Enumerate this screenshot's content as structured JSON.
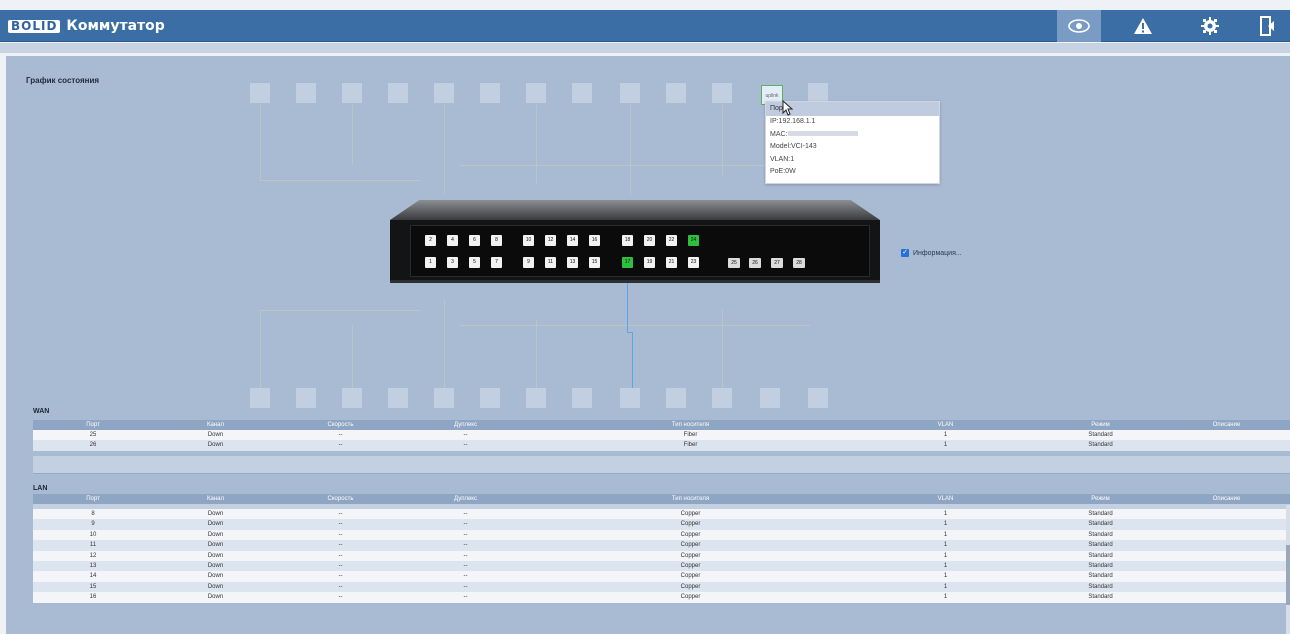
{
  "app": {
    "brand": "BOLID",
    "title": "Коммутатор"
  },
  "topbar": {
    "icons": [
      {
        "name": "eye-icon",
        "active": true
      },
      {
        "name": "alert-icon",
        "active": false
      },
      {
        "name": "gear-icon",
        "active": false
      },
      {
        "name": "logout-icon",
        "active": false
      }
    ]
  },
  "status_graph": {
    "title": "График состояния",
    "info_checkbox_label": "Информация..."
  },
  "tooltip": {
    "header": "Порт",
    "ip": "IP:192.168.1.1",
    "mac_prefix": "MAC:",
    "model": "Model:VCI-143",
    "vlan": "VLAN:1",
    "poe": "PoE:0W"
  },
  "hover_port_label": "uplink",
  "switch": {
    "top_row_ports": [
      "2",
      "4",
      "6",
      "8",
      "10",
      "12",
      "14",
      "16",
      "18",
      "20",
      "22",
      "24"
    ],
    "bottom_row_ports": [
      "1",
      "3",
      "5",
      "7",
      "9",
      "11",
      "13",
      "15",
      "17",
      "19",
      "21",
      "23"
    ],
    "sfp_ports": [
      "25",
      "26",
      "27",
      "28"
    ],
    "up_ports": [
      "17",
      "24"
    ]
  },
  "wan": {
    "label": "WAN",
    "columns": [
      "Порт",
      "Канал",
      "Скорость",
      "Дуплекс",
      "Тип носителя",
      "VLAN",
      "Режим",
      "Описание"
    ],
    "rows": [
      [
        "25",
        "Down",
        "--",
        "--",
        "Fiber",
        "1",
        "Standard",
        ""
      ],
      [
        "26",
        "Down",
        "--",
        "--",
        "Fiber",
        "1",
        "Standard",
        ""
      ]
    ]
  },
  "lan": {
    "label": "LAN",
    "columns": [
      "Порт",
      "Канал",
      "Скорость",
      "Дуплекс",
      "Тип носителя",
      "VLAN",
      "Режим",
      "Описание"
    ],
    "rows": [
      [
        "8",
        "Down",
        "--",
        "--",
        "Copper",
        "1",
        "Standard",
        ""
      ],
      [
        "9",
        "Down",
        "--",
        "--",
        "Copper",
        "1",
        "Standard",
        ""
      ],
      [
        "10",
        "Down",
        "--",
        "--",
        "Copper",
        "1",
        "Standard",
        ""
      ],
      [
        "11",
        "Down",
        "--",
        "--",
        "Copper",
        "1",
        "Standard",
        ""
      ],
      [
        "12",
        "Down",
        "--",
        "--",
        "Copper",
        "1",
        "Standard",
        ""
      ],
      [
        "13",
        "Down",
        "--",
        "--",
        "Copper",
        "1",
        "Standard",
        ""
      ],
      [
        "14",
        "Down",
        "--",
        "--",
        "Copper",
        "1",
        "Standard",
        ""
      ],
      [
        "15",
        "Down",
        "--",
        "--",
        "Copper",
        "1",
        "Standard",
        ""
      ],
      [
        "16",
        "Down",
        "--",
        "--",
        "Copper",
        "1",
        "Standard",
        ""
      ]
    ]
  },
  "colors": {
    "topbar": "#3a6ea5",
    "panel": "#a9bbd3",
    "port_up": "#2fbf3f",
    "active_wire": "#5aa7e6"
  }
}
